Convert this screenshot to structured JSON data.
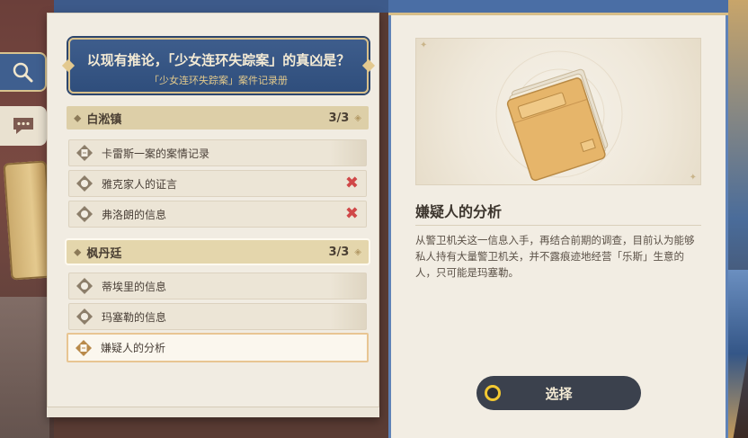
{
  "banner": {
    "title": "以现有推论，「少女连环失踪案」的真凶是？",
    "subtitle": "「少女连环失踪案」案件记录册"
  },
  "sections": [
    {
      "name": "白淞镇",
      "count": "3/3",
      "items": [
        {
          "label": "卡雷斯一案的案情记录",
          "icon": "document-icon",
          "crossed": false
        },
        {
          "label": "雅克家人的证言",
          "icon": "speech-icon",
          "crossed": true
        },
        {
          "label": "弗洛朗的信息",
          "icon": "speech-icon",
          "crossed": true
        }
      ]
    },
    {
      "name": "枫丹廷",
      "count": "3/3",
      "items": [
        {
          "label": "蒂埃里的信息",
          "icon": "speech-icon",
          "crossed": false
        },
        {
          "label": "玛塞勒的信息",
          "icon": "speech-icon",
          "crossed": false
        },
        {
          "label": "嫌疑人的分析",
          "icon": "document-icon",
          "crossed": false,
          "selected": true
        }
      ]
    }
  ],
  "detail": {
    "title": "嫌疑人的分析",
    "description": "从警卫机关这一信息入手，再结合前期的调查，目前认为能够私人持有大量警卫机关，并不露痕迹地经营「乐斯」生意的人，只可能是玛塞勒。"
  },
  "select_button": {
    "label": "选择"
  },
  "marks": {
    "cross": "✖"
  },
  "colors": {
    "banner_bg": "#3e5d8c",
    "gold": "#d8c08a",
    "cross_red": "#d04848",
    "button_ring": "#f2c832"
  }
}
